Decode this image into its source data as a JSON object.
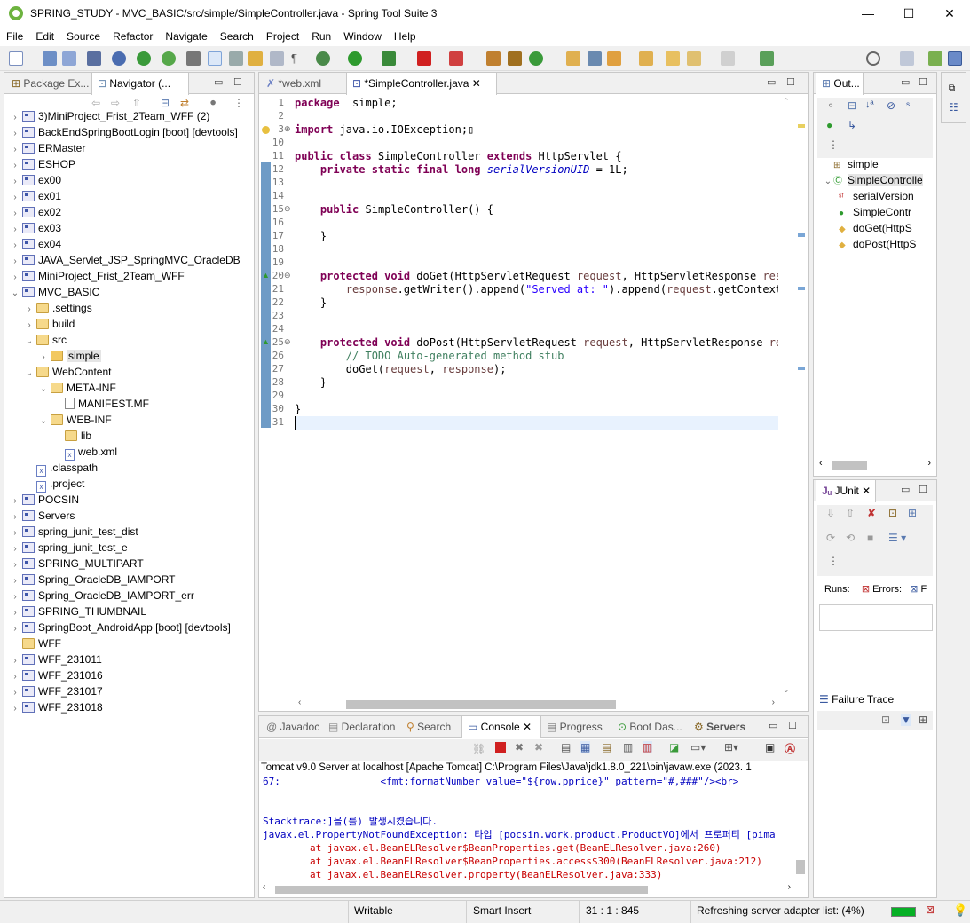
{
  "window": {
    "title": "SPRING_STUDY - MVC_BASIC/src/simple/SimpleController.java - Spring Tool Suite 3",
    "minimize": "—",
    "maximize": "☐",
    "close": "✕"
  },
  "menu": [
    "File",
    "Edit",
    "Source",
    "Refactor",
    "Navigate",
    "Search",
    "Project",
    "Run",
    "Window",
    "Help"
  ],
  "left_panel": {
    "tabs": [
      {
        "label": "Package Ex..."
      },
      {
        "label": "Navigator (..."
      }
    ],
    "tree": [
      {
        "indent": 0,
        "twisty": ">",
        "icon": "proj",
        "label": "3)MiniProject_Frist_2Team_WFF (2)"
      },
      {
        "indent": 0,
        "twisty": ">",
        "icon": "proj",
        "label": "BackEndSpringBootLogin [boot] [devtools]"
      },
      {
        "indent": 0,
        "twisty": ">",
        "icon": "proj",
        "label": "ERMaster"
      },
      {
        "indent": 0,
        "twisty": ">",
        "icon": "proj",
        "label": "ESHOP"
      },
      {
        "indent": 0,
        "twisty": ">",
        "icon": "proj",
        "label": "ex00"
      },
      {
        "indent": 0,
        "twisty": ">",
        "icon": "proj",
        "label": "ex01"
      },
      {
        "indent": 0,
        "twisty": ">",
        "icon": "proj",
        "label": "ex02"
      },
      {
        "indent": 0,
        "twisty": ">",
        "icon": "proj",
        "label": "ex03"
      },
      {
        "indent": 0,
        "twisty": ">",
        "icon": "proj",
        "label": "ex04"
      },
      {
        "indent": 0,
        "twisty": ">",
        "icon": "proj",
        "label": "JAVA_Servlet_JSP_SpringMVC_OracleDB"
      },
      {
        "indent": 0,
        "twisty": ">",
        "icon": "proj",
        "label": "MiniProject_Frist_2Team_WFF"
      },
      {
        "indent": 0,
        "twisty": "v",
        "icon": "proj",
        "label": "MVC_BASIC"
      },
      {
        "indent": 1,
        "twisty": ">",
        "icon": "folder",
        "label": ".settings"
      },
      {
        "indent": 1,
        "twisty": ">",
        "icon": "folder",
        "label": "build"
      },
      {
        "indent": 1,
        "twisty": "v",
        "icon": "folder",
        "label": "src"
      },
      {
        "indent": 2,
        "twisty": ">",
        "icon": "folder",
        "label": "simple",
        "selected": true
      },
      {
        "indent": 1,
        "twisty": "v",
        "icon": "folder",
        "label": "WebContent"
      },
      {
        "indent": 2,
        "twisty": "v",
        "icon": "folder",
        "label": "META-INF"
      },
      {
        "indent": 3,
        "twisty": "",
        "icon": "file",
        "label": "MANIFEST.MF"
      },
      {
        "indent": 2,
        "twisty": "v",
        "icon": "folder",
        "label": "WEB-INF"
      },
      {
        "indent": 3,
        "twisty": "",
        "icon": "folder",
        "label": "lib"
      },
      {
        "indent": 3,
        "twisty": "",
        "icon": "xml",
        "label": "web.xml"
      },
      {
        "indent": 1,
        "twisty": "",
        "icon": "xml",
        "label": ".classpath"
      },
      {
        "indent": 1,
        "twisty": "",
        "icon": "xml",
        "label": ".project"
      },
      {
        "indent": 0,
        "twisty": ">",
        "icon": "proj",
        "label": "POCSIN"
      },
      {
        "indent": 0,
        "twisty": ">",
        "icon": "proj",
        "label": "Servers"
      },
      {
        "indent": 0,
        "twisty": ">",
        "icon": "proj",
        "label": "spring_junit_test_dist"
      },
      {
        "indent": 0,
        "twisty": ">",
        "icon": "proj",
        "label": "spring_junit_test_e"
      },
      {
        "indent": 0,
        "twisty": ">",
        "icon": "proj",
        "label": "SPRING_MULTIPART"
      },
      {
        "indent": 0,
        "twisty": ">",
        "icon": "proj",
        "label": "Spring_OracleDB_IAMPORT"
      },
      {
        "indent": 0,
        "twisty": ">",
        "icon": "proj",
        "label": "Spring_OracleDB_IAMPORT_err"
      },
      {
        "indent": 0,
        "twisty": ">",
        "icon": "proj",
        "label": "SPRING_THUMBNAIL"
      },
      {
        "indent": 0,
        "twisty": ">",
        "icon": "proj",
        "label": "SpringBoot_AndroidApp [boot] [devtools]"
      },
      {
        "indent": 0,
        "twisty": "",
        "icon": "folder",
        "label": "WFF"
      },
      {
        "indent": 0,
        "twisty": ">",
        "icon": "proj",
        "label": "WFF_231011"
      },
      {
        "indent": 0,
        "twisty": ">",
        "icon": "proj",
        "label": "WFF_231016"
      },
      {
        "indent": 0,
        "twisty": ">",
        "icon": "proj",
        "label": "WFF_231017"
      },
      {
        "indent": 0,
        "twisty": ">",
        "icon": "proj",
        "label": "WFF_231018"
      }
    ]
  },
  "editor": {
    "tabs": [
      {
        "label": "*web.xml"
      },
      {
        "label": "*SimpleController.java",
        "close": "✕"
      }
    ],
    "lines": [
      {
        "n": "1",
        "seg": [
          [
            "kw",
            "package"
          ],
          [
            "",
            "  simple;"
          ]
        ]
      },
      {
        "n": "2",
        "seg": []
      },
      {
        "n": "3",
        "seg": [
          [
            "kw",
            "import"
          ],
          [
            "",
            " java.io.IOException;"
          ],
          [
            "",
            "▯"
          ]
        ]
      },
      {
        "n": "10",
        "seg": []
      },
      {
        "n": "11",
        "seg": [
          [
            "kw",
            "public class"
          ],
          [
            "",
            " SimpleController "
          ],
          [
            "kw",
            "extends"
          ],
          [
            "",
            " HttpServlet {"
          ]
        ]
      },
      {
        "n": "12",
        "seg": [
          [
            "",
            "    "
          ],
          [
            "kw",
            "private static final long"
          ],
          [
            "",
            " "
          ],
          [
            "fld",
            "serialVersionUID"
          ],
          [
            "",
            " = 1L;"
          ]
        ]
      },
      {
        "n": "13",
        "seg": []
      },
      {
        "n": "14",
        "seg": []
      },
      {
        "n": "15",
        "seg": [
          [
            "",
            "    "
          ],
          [
            "kw",
            "public"
          ],
          [
            "",
            " SimpleController() {"
          ]
        ]
      },
      {
        "n": "16",
        "seg": []
      },
      {
        "n": "17",
        "seg": [
          [
            "",
            "    }"
          ]
        ]
      },
      {
        "n": "18",
        "seg": []
      },
      {
        "n": "19",
        "seg": []
      },
      {
        "n": "20",
        "seg": [
          [
            "",
            "    "
          ],
          [
            "kw",
            "protected void"
          ],
          [
            "",
            " doGet(HttpServletRequest "
          ],
          [
            "param",
            "request"
          ],
          [
            "",
            ", HttpServletResponse "
          ],
          [
            "param",
            "respo"
          ]
        ]
      },
      {
        "n": "21",
        "seg": [
          [
            "",
            "        "
          ],
          [
            "param",
            "response"
          ],
          [
            "",
            ".getWriter().append("
          ],
          [
            "str",
            "\"Served at: \""
          ],
          [
            "",
            ").append("
          ],
          [
            "param",
            "request"
          ],
          [
            "",
            ".getContextPa"
          ]
        ]
      },
      {
        "n": "22",
        "seg": [
          [
            "",
            "    }"
          ]
        ]
      },
      {
        "n": "23",
        "seg": []
      },
      {
        "n": "24",
        "seg": []
      },
      {
        "n": "25",
        "seg": [
          [
            "",
            "    "
          ],
          [
            "kw",
            "protected void"
          ],
          [
            "",
            " doPost(HttpServletRequest "
          ],
          [
            "param",
            "request"
          ],
          [
            "",
            ", HttpServletResponse "
          ],
          [
            "param",
            "respo"
          ]
        ]
      },
      {
        "n": "26",
        "seg": [
          [
            "",
            "        "
          ],
          [
            "cmt",
            "// TODO Auto-generated method stub"
          ]
        ]
      },
      {
        "n": "27",
        "seg": [
          [
            "",
            "        doGet("
          ],
          [
            "param",
            "request"
          ],
          [
            "",
            ", "
          ],
          [
            "param",
            "response"
          ],
          [
            "",
            ");"
          ]
        ]
      },
      {
        "n": "28",
        "seg": [
          [
            "",
            "    }"
          ]
        ]
      },
      {
        "n": "29",
        "seg": []
      },
      {
        "n": "30",
        "seg": [
          [
            "",
            "}"
          ]
        ]
      },
      {
        "n": "31",
        "seg": []
      }
    ]
  },
  "outline": {
    "tab": {
      "label": "Out..."
    },
    "items": [
      {
        "indent": 0,
        "icon": "package",
        "label": "simple"
      },
      {
        "indent": 0,
        "icon": "class",
        "label": "SimpleControlle",
        "selected": true
      },
      {
        "indent": 1,
        "icon": "field",
        "label": "serialVersion"
      },
      {
        "indent": 1,
        "icon": "ctor",
        "label": "SimpleContr"
      },
      {
        "indent": 1,
        "icon": "method",
        "label": "doGet(HttpS"
      },
      {
        "indent": 1,
        "icon": "method",
        "label": "doPost(HttpS"
      }
    ]
  },
  "junit": {
    "tab": {
      "label": "JUnit"
    },
    "runs_label": "Runs:",
    "errors_label": "Errors:",
    "failures_label": "F",
    "failure_trace": "Failure Trace"
  },
  "bottom": {
    "tabs": [
      {
        "label": "Javadoc"
      },
      {
        "label": "Declaration"
      },
      {
        "label": "Search"
      },
      {
        "label": "Console",
        "close": "✕"
      },
      {
        "label": "Progress"
      },
      {
        "label": "Boot Das..."
      },
      {
        "label": "Servers"
      }
    ],
    "header": "Tomcat v9.0 Server at localhost [Apache Tomcat] C:\\Program Files\\Java\\jdk1.8.0_221\\bin\\javaw.exe  (2023. 1",
    "lines": [
      {
        "cls": "blue",
        "text": "67:                 <fmt:formatNumber value=\"${row.pprice}\" pattern=\"#,###\"/><br>"
      },
      {
        "cls": "",
        "text": ""
      },
      {
        "cls": "",
        "text": ""
      },
      {
        "cls": "blue",
        "text": "Stacktrace:]을(를) 발생시켰습니다."
      },
      {
        "cls": "blue",
        "text": "javax.el.PropertyNotFoundException: 타입 [pocsin.work.product.ProductVO]에서 프로퍼티 [pima"
      },
      {
        "cls": "red",
        "text": "        at javax.el.BeanELResolver$BeanProperties.get(BeanELResolver.java:260)"
      },
      {
        "cls": "red",
        "text": "        at javax.el.BeanELResolver$BeanProperties.access$300(BeanELResolver.java:212)"
      },
      {
        "cls": "red",
        "text": "        at javax.el.BeanELResolver.property(BeanELResolver.java:333)"
      }
    ]
  },
  "status": {
    "writable": "Writable",
    "insert": "Smart Insert",
    "position": "31 : 1 : 845",
    "task": "Refreshing server adapter list: (4%)"
  }
}
